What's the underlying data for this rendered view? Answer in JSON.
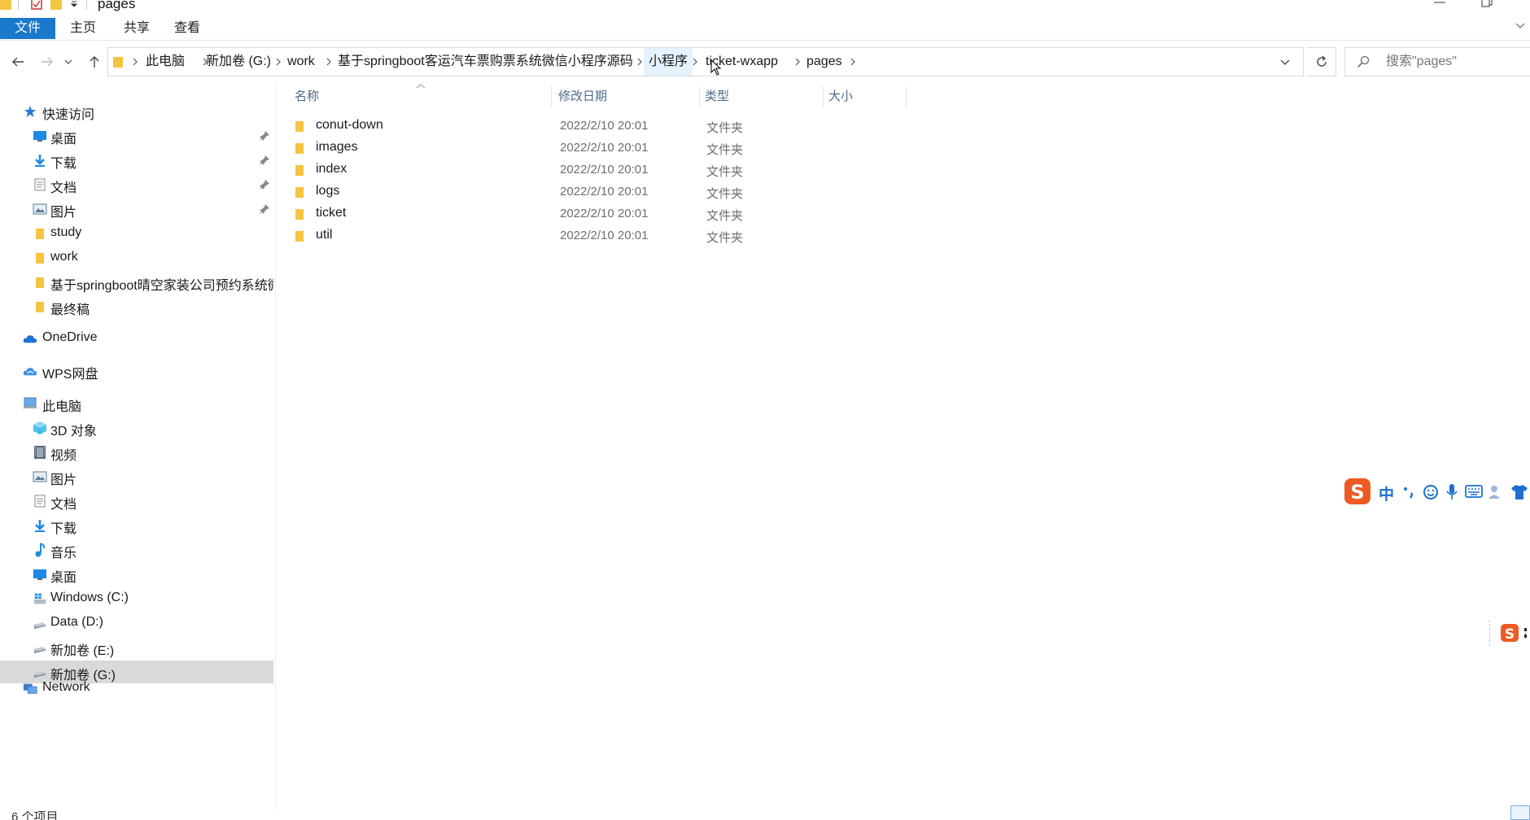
{
  "window": {
    "title": "pages"
  },
  "ribbon": {
    "tabs": [
      "文件",
      "主页",
      "共享",
      "查看"
    ]
  },
  "address": {
    "crumbs": [
      "此电脑",
      "新加卷 (G:)",
      "work",
      "基于springboot客运汽车票购票系统微信小程序源码",
      "小程序",
      "ticket-wxapp",
      "pages"
    ]
  },
  "search": {
    "placeholder": "搜索\"pages\""
  },
  "sidebar": {
    "quick_access": "快速访问",
    "quick_items": [
      {
        "label": "桌面",
        "pinned": true,
        "icon": "desktop-icon"
      },
      {
        "label": "下载",
        "pinned": true,
        "icon": "download-icon"
      },
      {
        "label": "文档",
        "pinned": true,
        "icon": "document-icon"
      },
      {
        "label": "图片",
        "pinned": true,
        "icon": "picture-icon"
      },
      {
        "label": "study",
        "pinned": false,
        "icon": "folder-icon"
      },
      {
        "label": "work",
        "pinned": false,
        "icon": "folder-icon"
      },
      {
        "label": "基于springboot晴空家装公司预约系统微",
        "pinned": false,
        "icon": "folder-icon"
      },
      {
        "label": "最终稿",
        "pinned": false,
        "icon": "folder-icon"
      }
    ],
    "onedrive": "OneDrive",
    "wps": "WPS网盘",
    "this_pc": "此电脑",
    "pc_items": [
      {
        "label": "3D 对象",
        "icon": "3d-objects-icon"
      },
      {
        "label": "视频",
        "icon": "video-icon"
      },
      {
        "label": "图片",
        "icon": "picture-icon"
      },
      {
        "label": "文档",
        "icon": "document-icon"
      },
      {
        "label": "下载",
        "icon": "download-icon"
      },
      {
        "label": "音乐",
        "icon": "music-icon"
      },
      {
        "label": "桌面",
        "icon": "desktop-icon"
      },
      {
        "label": "Windows (C:)",
        "icon": "windows-drive-icon"
      },
      {
        "label": "Data (D:)",
        "icon": "drive-icon"
      },
      {
        "label": "新加卷 (E:)",
        "icon": "drive-icon"
      },
      {
        "label": "新加卷 (G:)",
        "icon": "drive-icon",
        "selected": true
      }
    ],
    "network": "Network"
  },
  "columns": [
    "名称",
    "修改日期",
    "类型",
    "大小"
  ],
  "files": [
    {
      "name": "conut-down",
      "date": "2022/2/10 20:01",
      "type": "文件夹"
    },
    {
      "name": "images",
      "date": "2022/2/10 20:01",
      "type": "文件夹"
    },
    {
      "name": "index",
      "date": "2022/2/10 20:01",
      "type": "文件夹"
    },
    {
      "name": "logs",
      "date": "2022/2/10 20:01",
      "type": "文件夹"
    },
    {
      "name": "ticket",
      "date": "2022/2/10 20:01",
      "type": "文件夹"
    },
    {
      "name": "util",
      "date": "2022/2/10 20:01",
      "type": "文件夹"
    }
  ],
  "status": {
    "count": "6 个项目"
  },
  "ime": {
    "mode": "中"
  },
  "colors": {
    "accent": "#1979ca",
    "folder": "#f5c542",
    "selected": "#d9d9d9",
    "header_text": "#4d6b8a"
  }
}
